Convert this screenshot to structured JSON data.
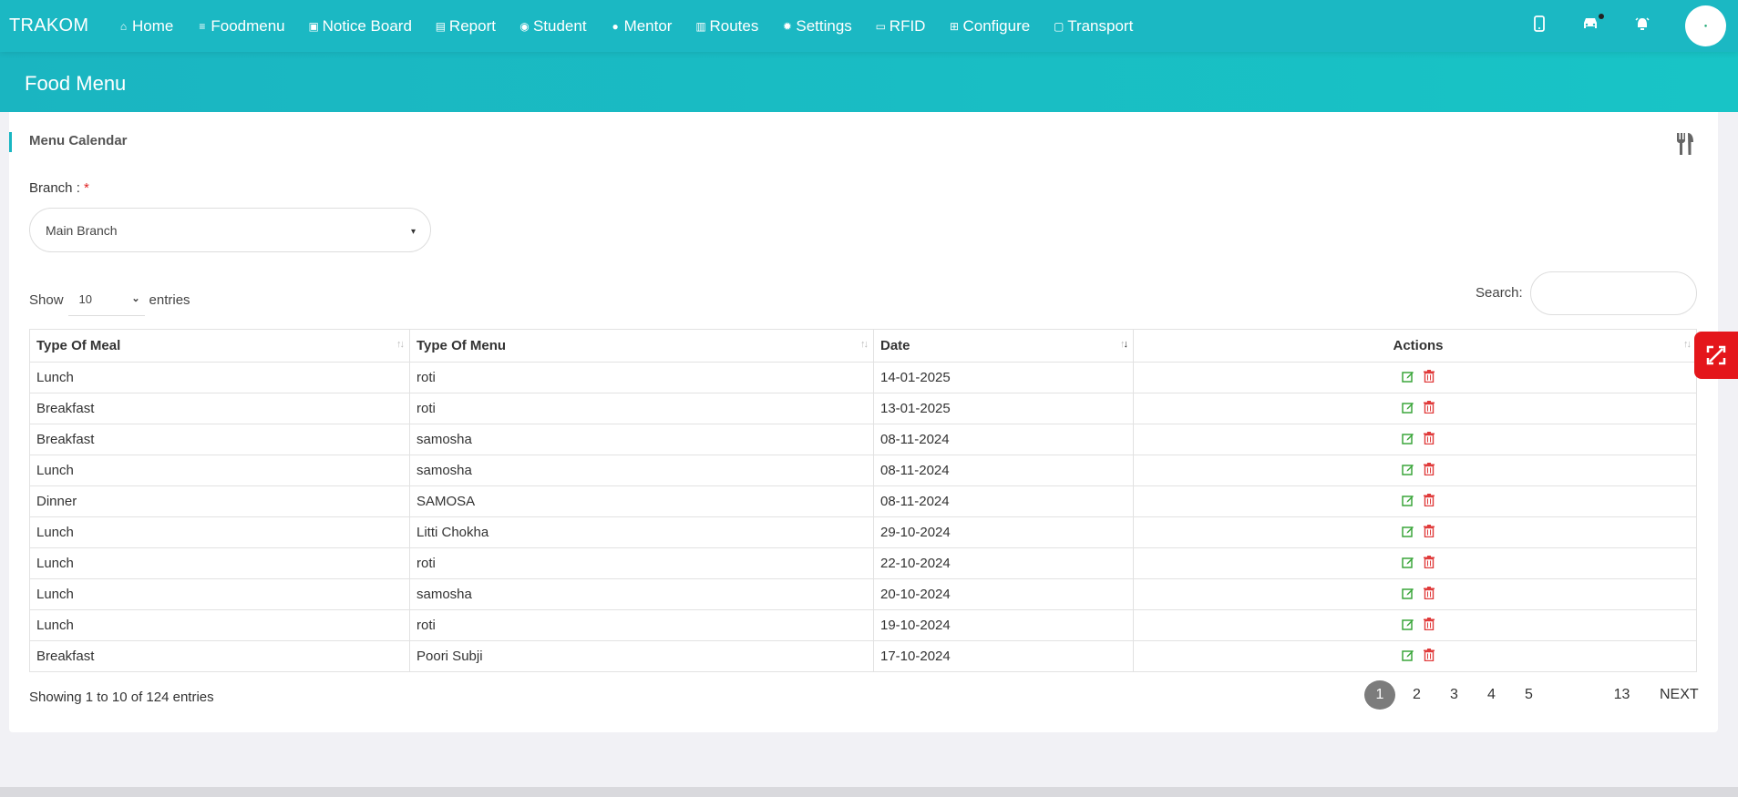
{
  "nav": {
    "brand": "TRAKOM",
    "items": [
      {
        "label": "Home",
        "icon": "home-icon",
        "glyph": "⌂"
      },
      {
        "label": "Foodmenu",
        "icon": "list-icon",
        "glyph": "≡"
      },
      {
        "label": "Notice Board",
        "icon": "notice-icon",
        "glyph": "▣"
      },
      {
        "label": "Report",
        "icon": "file-icon",
        "glyph": "▤"
      },
      {
        "label": "Student",
        "icon": "student-icon",
        "glyph": "◉"
      },
      {
        "label": "Mentor",
        "icon": "user-icon",
        "glyph": "●"
      },
      {
        "label": "Routes",
        "icon": "map-icon",
        "glyph": "▥"
      },
      {
        "label": "Settings",
        "icon": "gear-icon",
        "glyph": "✹"
      },
      {
        "label": "RFID",
        "icon": "card-icon",
        "glyph": "▭"
      },
      {
        "label": "Configure",
        "icon": "configure-icon",
        "glyph": "⊞"
      },
      {
        "label": "Transport",
        "icon": "bus-icon",
        "glyph": "▢"
      }
    ]
  },
  "page": {
    "title": "Food Menu"
  },
  "card": {
    "title": "Menu Calendar"
  },
  "branch": {
    "label": "Branch :",
    "required": "*",
    "value": "Main Branch"
  },
  "length": {
    "show": "Show",
    "value": "10",
    "entries": "entries"
  },
  "search": {
    "label": "Search:",
    "value": ""
  },
  "table": {
    "headers": [
      "Type Of Meal",
      "Type Of Menu",
      "Date",
      "Actions"
    ],
    "rows": [
      [
        "Lunch",
        "roti",
        "14-01-2025"
      ],
      [
        "Breakfast",
        "roti",
        "13-01-2025"
      ],
      [
        "Breakfast",
        "samosha",
        "08-11-2024"
      ],
      [
        "Lunch",
        "samosha",
        "08-11-2024"
      ],
      [
        "Dinner",
        "SAMOSA",
        "08-11-2024"
      ],
      [
        "Lunch",
        "Litti Chokha",
        "29-10-2024"
      ],
      [
        "Lunch",
        "roti",
        "22-10-2024"
      ],
      [
        "Lunch",
        "samosha",
        "20-10-2024"
      ],
      [
        "Lunch",
        "roti",
        "19-10-2024"
      ],
      [
        "Breakfast",
        "Poori Subji",
        "17-10-2024"
      ]
    ]
  },
  "info": "Showing 1 to 10 of 124 entries",
  "pagination": {
    "pages": [
      "1",
      "2",
      "3",
      "4",
      "5"
    ],
    "last": "13",
    "next": "NEXT",
    "active": "1"
  },
  "colors": {
    "accent": "#18b6c2",
    "edit": "#3aa53a",
    "delete": "#e03b3b",
    "badge": "#e4161b"
  }
}
